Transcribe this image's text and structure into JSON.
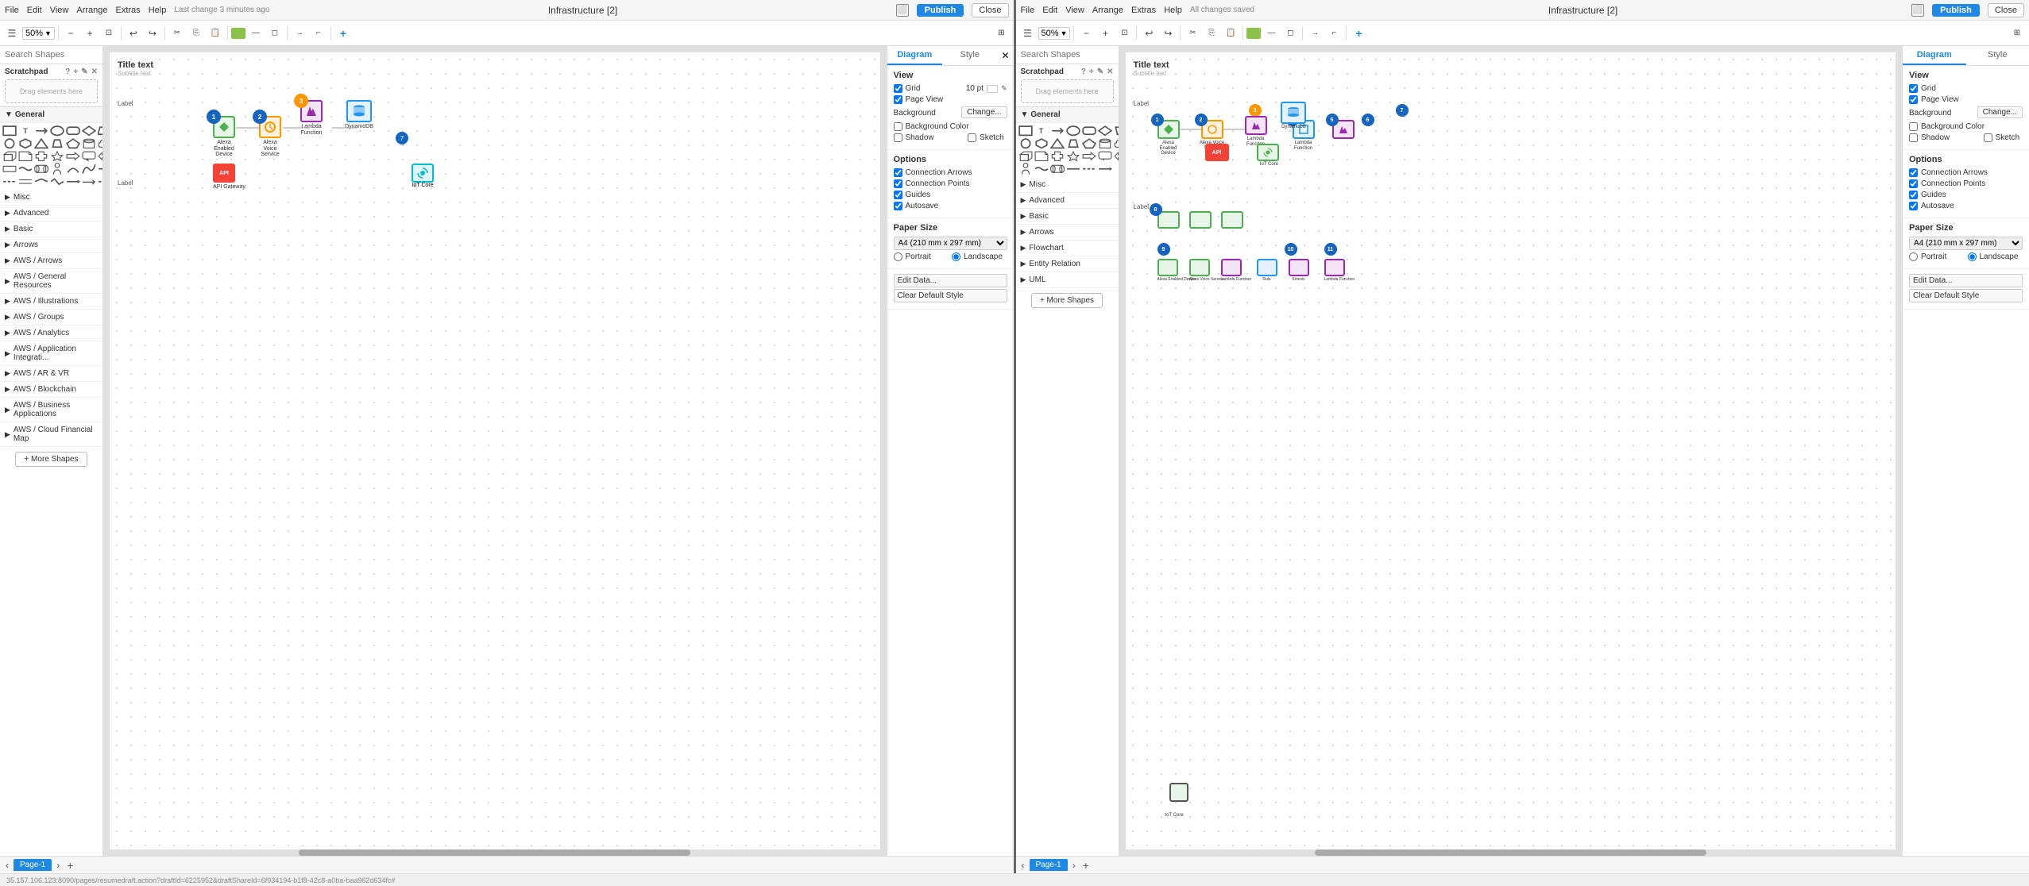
{
  "windows": [
    {
      "id": "window-1",
      "menubar": {
        "file": "File",
        "edit": "Edit",
        "view": "View",
        "arrange": "Arrange",
        "extras": "Extras",
        "help": "Help",
        "status": "Last change 3 minutes ago"
      },
      "title": "Infrastructure [2]",
      "publish_label": "Publish",
      "close_label": "Close",
      "toolbar": {
        "zoom": "50%"
      },
      "search_placeholder": "Search Shapes",
      "scratchpad_label": "Scratchpad",
      "drag_label": "Drag elements here",
      "shapes_sections": {
        "general_label": "General",
        "misc_label": "Misc",
        "advanced_label": "Advanced",
        "basic_label": "Basic",
        "arrows_label": "Arrows",
        "aws_arrows_label": "AWS / Arrows",
        "aws_general_label": "AWS / General Resources",
        "aws_illus_label": "AWS / Illustrations",
        "aws_groups_label": "AWS / Groups",
        "aws_analytics_label": "AWS / Analytics",
        "aws_app_label": "AWS / Application Integrati...",
        "aws_ar_label": "AWS / AR & VR",
        "aws_blockchain_label": "AWS / Blockchain",
        "aws_business_label": "AWS / Business Applications",
        "aws_cloud_label": "AWS / Cloud Financial Map",
        "more_shapes": "+ More Shapes"
      },
      "diagram_panel": {
        "tabs": [
          "Diagram",
          "Style"
        ],
        "active_tab": 0,
        "view_section": {
          "title": "View",
          "grid_checked": true,
          "grid_label": "Grid",
          "grid_value": "10 pt",
          "page_view_checked": true,
          "page_view_label": "Page View",
          "background_label": "Background",
          "change_label": "Change...",
          "bg_color_checked": false,
          "bg_color_label": "Background Color",
          "shadow_checked": false,
          "shadow_label": "Shadow",
          "sketch_checked": false,
          "sketch_label": "Sketch"
        },
        "options_section": {
          "title": "Options",
          "conn_arrows_checked": true,
          "conn_arrows_label": "Connection Arrows",
          "conn_points_checked": true,
          "conn_points_label": "Connection Points",
          "guides_checked": true,
          "guides_label": "Guides",
          "autosave_checked": true,
          "autosave_label": "Autosave"
        },
        "paper_section": {
          "title": "Paper Size",
          "size_value": "A4 (210 mm x 297 mm)",
          "portrait_label": "Portrait",
          "landscape_label": "Landscape",
          "landscape_checked": true
        },
        "edit_data_label": "Edit Data...",
        "clear_style_label": "Clear Default Style"
      },
      "canvas": {
        "title": "Title text",
        "subtitle": "Subtitle text",
        "label1": "Label",
        "label2": "Label"
      },
      "page_tabs": [
        "Page-1"
      ],
      "active_page": 0
    },
    {
      "id": "window-2",
      "menubar": {
        "file": "File",
        "edit": "Edit",
        "view": "View",
        "arrange": "Arrange",
        "extras": "Extras",
        "help": "Help",
        "status": "All changes saved"
      },
      "title": "Infrastructure [2]",
      "publish_label": "Publish",
      "close_label": "Close",
      "toolbar": {
        "zoom": "50%"
      },
      "search_placeholder": "Search Shapes",
      "scratchpad_label": "Scratchpad",
      "drag_label": "Drag elements here",
      "shapes_sections": {
        "general_label": "General",
        "misc_label": "Misc",
        "advanced_label": "Advanced",
        "basic_label": "Basic",
        "arrows_label": "Arrows",
        "flowchart_label": "Flowchart",
        "entity_relation_label": "Entity Relation",
        "uml_label": "UML",
        "more_shapes": "+ More Shapes"
      },
      "diagram_panel": {
        "tabs": [
          "Diagram",
          "Style"
        ],
        "active_tab": 0,
        "view_section": {
          "title": "View",
          "grid_checked": true,
          "grid_label": "Grid",
          "page_view_checked": true,
          "page_view_label": "Page View",
          "background_label": "Background",
          "change_label": "Change...",
          "bg_color_checked": false,
          "bg_color_label": "Background Color",
          "shadow_checked": false,
          "shadow_label": "Shadow",
          "sketch_checked": false,
          "sketch_label": "Sketch"
        },
        "options_section": {
          "title": "Options",
          "conn_arrows_checked": true,
          "conn_arrows_label": "Connection Arrows",
          "conn_points_checked": true,
          "conn_points_label": "Connection Points",
          "guides_checked": true,
          "guides_label": "Guides",
          "autosave_checked": true,
          "autosave_label": "Autosave"
        },
        "paper_section": {
          "title": "Paper Size",
          "size_value": "A4 (210 mm x 297 mm)",
          "portrait_label": "Portrait",
          "landscape_label": "Landscape",
          "landscape_checked": true
        },
        "edit_data_label": "Edit Data...",
        "clear_style_label": "Clear Default Style"
      },
      "canvas": {
        "title": "Title text",
        "subtitle": "Subtitle text",
        "label1": "Label",
        "label2": "Label"
      },
      "page_tabs": [
        "Page-1"
      ],
      "active_page": 0
    }
  ],
  "status_bar": {
    "url": "35.157.106.123:8090/pages/resumedraft.action?draftId=6225952&draftShareId=6f934194-b1f8-42c8-a0ba-baa962d634fc#"
  },
  "colors": {
    "accent": "#1e88e5",
    "border": "#ddd",
    "bg": "#f5f5f5",
    "publish": "#1e88e5",
    "green": "#4caf50",
    "red": "#f44336",
    "blue": "#2196f3",
    "purple": "#9c27b0"
  }
}
